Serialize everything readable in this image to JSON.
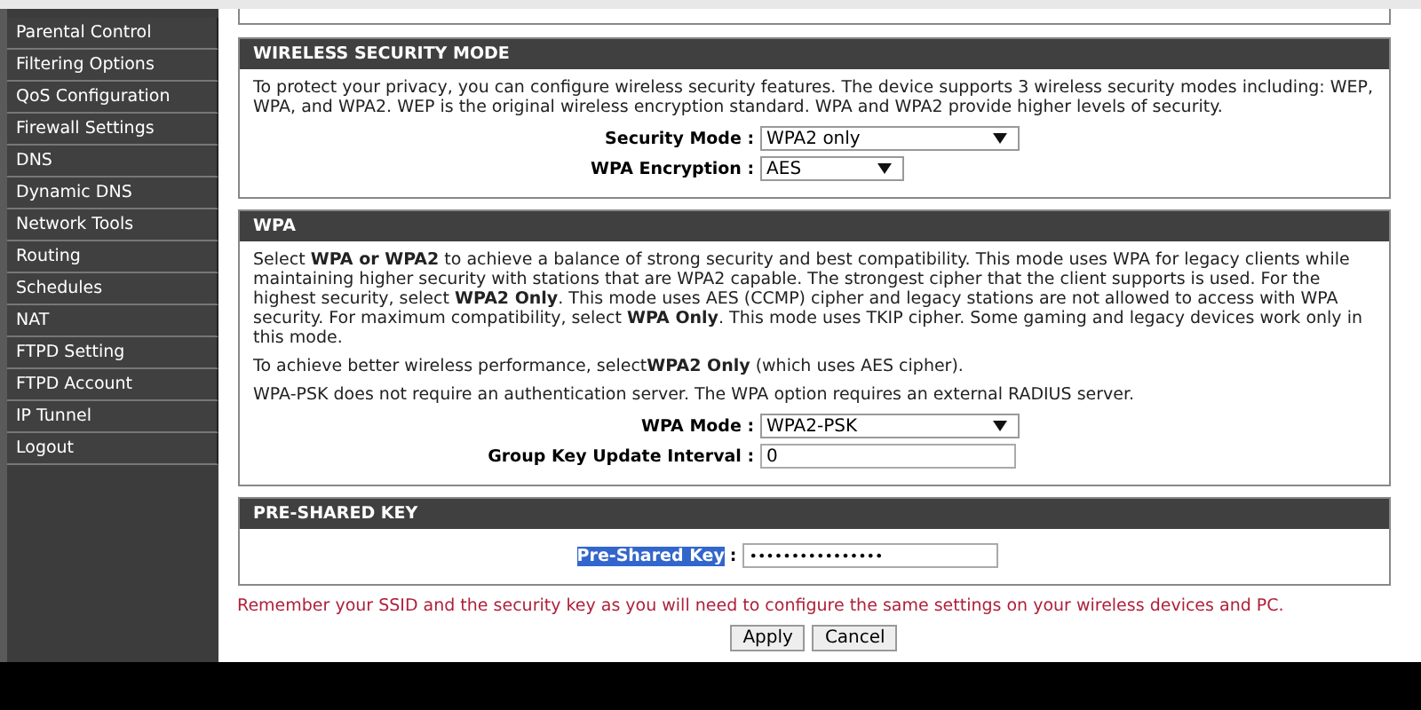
{
  "sidebar": {
    "items": [
      {
        "label": "Parental Control"
      },
      {
        "label": "Filtering Options"
      },
      {
        "label": "QoS Configuration"
      },
      {
        "label": "Firewall Settings"
      },
      {
        "label": "DNS"
      },
      {
        "label": "Dynamic DNS"
      },
      {
        "label": "Network Tools"
      },
      {
        "label": "Routing"
      },
      {
        "label": "Schedules"
      },
      {
        "label": "NAT"
      },
      {
        "label": "FTPD Setting"
      },
      {
        "label": "FTPD Account"
      },
      {
        "label": "IP Tunnel"
      },
      {
        "label": "Logout"
      }
    ]
  },
  "sections": [
    {
      "title": "WIRELESS SECURITY MODE",
      "paragraphs": [
        "To protect your privacy, you can configure wireless security features. The device supports 3 wireless security modes including: WEP, WPA, and WPA2. WEP is the original wireless encryption standard. WPA and WPA2 provide higher levels of security."
      ],
      "fields": [
        {
          "kind": "select",
          "label": "Security Mode :",
          "value": "WPA2 only",
          "wide": true
        },
        {
          "kind": "select",
          "label": "WPA Encryption :",
          "value": "AES",
          "wide": false
        }
      ]
    },
    {
      "title": "WPA",
      "paragraphs": [
        "Select **WPA or WPA2** to achieve a balance of strong security and best compatibility. This mode uses WPA for legacy clients while maintaining higher security with stations that are WPA2 capable. The strongest cipher that the client supports is used. For the highest security, select **WPA2 Only**. This mode uses AES (CCMP) cipher and legacy stations are not allowed to access with WPA security. For maximum compatibility, select **WPA Only**. This mode uses TKIP cipher. Some gaming and legacy devices work only in this mode.",
        "To achieve better wireless performance, select**WPA2 Only** (which uses AES cipher).",
        "WPA-PSK does not require an authentication server. The WPA option requires an external RADIUS server."
      ],
      "fields": [
        {
          "kind": "select",
          "label": "WPA Mode :",
          "value": "WPA2-PSK",
          "wide": true
        },
        {
          "kind": "text",
          "label": "Group Key Update Interval :",
          "value": "0",
          "wide": true
        }
      ]
    },
    {
      "title": "PRE-SHARED KEY",
      "fields": [
        {
          "kind": "password",
          "label": "Pre-Shared Key",
          "separator": ":",
          "highlighted": true,
          "value": "••••••••••••••••",
          "wide": true
        }
      ]
    }
  ],
  "note": "Remember your SSID and the security key as you will need to configure the same settings on your wireless devices and PC.",
  "buttons": [
    "Apply",
    "Cancel"
  ]
}
